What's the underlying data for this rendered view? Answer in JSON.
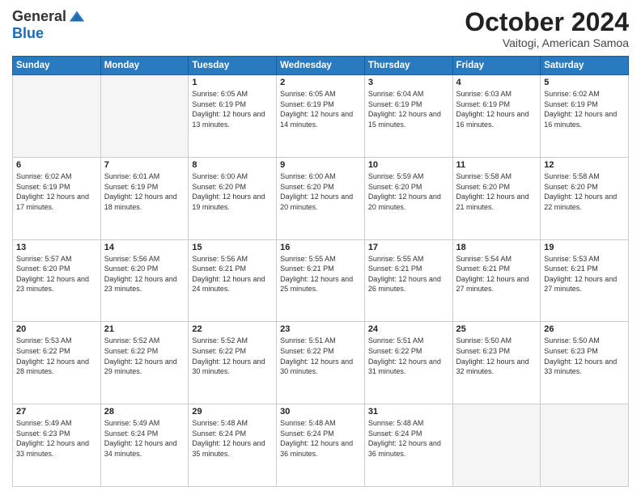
{
  "header": {
    "logo_general": "General",
    "logo_blue": "Blue",
    "month_title": "October 2024",
    "location": "Vaitogi, American Samoa"
  },
  "weekdays": [
    "Sunday",
    "Monday",
    "Tuesday",
    "Wednesday",
    "Thursday",
    "Friday",
    "Saturday"
  ],
  "weeks": [
    [
      {
        "day": "",
        "empty": true
      },
      {
        "day": "",
        "empty": true
      },
      {
        "day": "1",
        "sunrise": "Sunrise: 6:05 AM",
        "sunset": "Sunset: 6:19 PM",
        "daylight": "Daylight: 12 hours and 13 minutes."
      },
      {
        "day": "2",
        "sunrise": "Sunrise: 6:05 AM",
        "sunset": "Sunset: 6:19 PM",
        "daylight": "Daylight: 12 hours and 14 minutes."
      },
      {
        "day": "3",
        "sunrise": "Sunrise: 6:04 AM",
        "sunset": "Sunset: 6:19 PM",
        "daylight": "Daylight: 12 hours and 15 minutes."
      },
      {
        "day": "4",
        "sunrise": "Sunrise: 6:03 AM",
        "sunset": "Sunset: 6:19 PM",
        "daylight": "Daylight: 12 hours and 16 minutes."
      },
      {
        "day": "5",
        "sunrise": "Sunrise: 6:02 AM",
        "sunset": "Sunset: 6:19 PM",
        "daylight": "Daylight: 12 hours and 16 minutes."
      }
    ],
    [
      {
        "day": "6",
        "sunrise": "Sunrise: 6:02 AM",
        "sunset": "Sunset: 6:19 PM",
        "daylight": "Daylight: 12 hours and 17 minutes."
      },
      {
        "day": "7",
        "sunrise": "Sunrise: 6:01 AM",
        "sunset": "Sunset: 6:19 PM",
        "daylight": "Daylight: 12 hours and 18 minutes."
      },
      {
        "day": "8",
        "sunrise": "Sunrise: 6:00 AM",
        "sunset": "Sunset: 6:20 PM",
        "daylight": "Daylight: 12 hours and 19 minutes."
      },
      {
        "day": "9",
        "sunrise": "Sunrise: 6:00 AM",
        "sunset": "Sunset: 6:20 PM",
        "daylight": "Daylight: 12 hours and 20 minutes."
      },
      {
        "day": "10",
        "sunrise": "Sunrise: 5:59 AM",
        "sunset": "Sunset: 6:20 PM",
        "daylight": "Daylight: 12 hours and 20 minutes."
      },
      {
        "day": "11",
        "sunrise": "Sunrise: 5:58 AM",
        "sunset": "Sunset: 6:20 PM",
        "daylight": "Daylight: 12 hours and 21 minutes."
      },
      {
        "day": "12",
        "sunrise": "Sunrise: 5:58 AM",
        "sunset": "Sunset: 6:20 PM",
        "daylight": "Daylight: 12 hours and 22 minutes."
      }
    ],
    [
      {
        "day": "13",
        "sunrise": "Sunrise: 5:57 AM",
        "sunset": "Sunset: 6:20 PM",
        "daylight": "Daylight: 12 hours and 23 minutes."
      },
      {
        "day": "14",
        "sunrise": "Sunrise: 5:56 AM",
        "sunset": "Sunset: 6:20 PM",
        "daylight": "Daylight: 12 hours and 23 minutes."
      },
      {
        "day": "15",
        "sunrise": "Sunrise: 5:56 AM",
        "sunset": "Sunset: 6:21 PM",
        "daylight": "Daylight: 12 hours and 24 minutes."
      },
      {
        "day": "16",
        "sunrise": "Sunrise: 5:55 AM",
        "sunset": "Sunset: 6:21 PM",
        "daylight": "Daylight: 12 hours and 25 minutes."
      },
      {
        "day": "17",
        "sunrise": "Sunrise: 5:55 AM",
        "sunset": "Sunset: 6:21 PM",
        "daylight": "Daylight: 12 hours and 26 minutes."
      },
      {
        "day": "18",
        "sunrise": "Sunrise: 5:54 AM",
        "sunset": "Sunset: 6:21 PM",
        "daylight": "Daylight: 12 hours and 27 minutes."
      },
      {
        "day": "19",
        "sunrise": "Sunrise: 5:53 AM",
        "sunset": "Sunset: 6:21 PM",
        "daylight": "Daylight: 12 hours and 27 minutes."
      }
    ],
    [
      {
        "day": "20",
        "sunrise": "Sunrise: 5:53 AM",
        "sunset": "Sunset: 6:22 PM",
        "daylight": "Daylight: 12 hours and 28 minutes."
      },
      {
        "day": "21",
        "sunrise": "Sunrise: 5:52 AM",
        "sunset": "Sunset: 6:22 PM",
        "daylight": "Daylight: 12 hours and 29 minutes."
      },
      {
        "day": "22",
        "sunrise": "Sunrise: 5:52 AM",
        "sunset": "Sunset: 6:22 PM",
        "daylight": "Daylight: 12 hours and 30 minutes."
      },
      {
        "day": "23",
        "sunrise": "Sunrise: 5:51 AM",
        "sunset": "Sunset: 6:22 PM",
        "daylight": "Daylight: 12 hours and 30 minutes."
      },
      {
        "day": "24",
        "sunrise": "Sunrise: 5:51 AM",
        "sunset": "Sunset: 6:22 PM",
        "daylight": "Daylight: 12 hours and 31 minutes."
      },
      {
        "day": "25",
        "sunrise": "Sunrise: 5:50 AM",
        "sunset": "Sunset: 6:23 PM",
        "daylight": "Daylight: 12 hours and 32 minutes."
      },
      {
        "day": "26",
        "sunrise": "Sunrise: 5:50 AM",
        "sunset": "Sunset: 6:23 PM",
        "daylight": "Daylight: 12 hours and 33 minutes."
      }
    ],
    [
      {
        "day": "27",
        "sunrise": "Sunrise: 5:49 AM",
        "sunset": "Sunset: 6:23 PM",
        "daylight": "Daylight: 12 hours and 33 minutes."
      },
      {
        "day": "28",
        "sunrise": "Sunrise: 5:49 AM",
        "sunset": "Sunset: 6:24 PM",
        "daylight": "Daylight: 12 hours and 34 minutes."
      },
      {
        "day": "29",
        "sunrise": "Sunrise: 5:48 AM",
        "sunset": "Sunset: 6:24 PM",
        "daylight": "Daylight: 12 hours and 35 minutes."
      },
      {
        "day": "30",
        "sunrise": "Sunrise: 5:48 AM",
        "sunset": "Sunset: 6:24 PM",
        "daylight": "Daylight: 12 hours and 36 minutes."
      },
      {
        "day": "31",
        "sunrise": "Sunrise: 5:48 AM",
        "sunset": "Sunset: 6:24 PM",
        "daylight": "Daylight: 12 hours and 36 minutes."
      },
      {
        "day": "",
        "empty": true
      },
      {
        "day": "",
        "empty": true
      }
    ]
  ]
}
